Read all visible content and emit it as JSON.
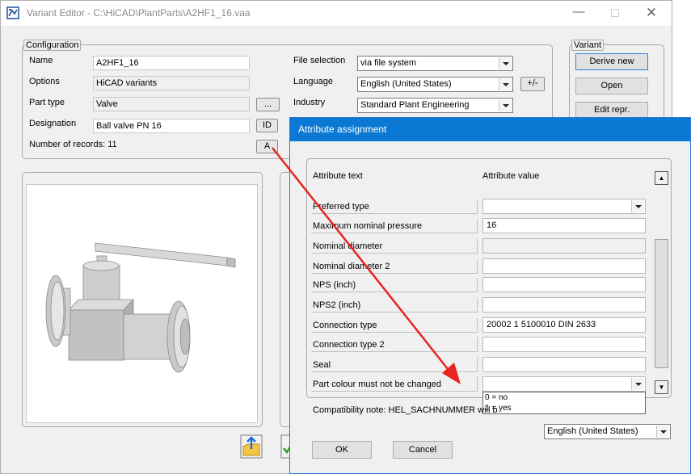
{
  "main_window": {
    "title": "Variant Editor - C:\\HiCAD\\PlantParts\\A2HF1_16.vaa",
    "configuration_group": "Configuration",
    "variant_group": "Variant",
    "fields": {
      "name_label": "Name",
      "name_value": "A2HF1_16",
      "options_label": "Options",
      "options_value": "HiCAD variants",
      "part_type_label": "Part type",
      "part_type_value": "Valve",
      "designation_label": "Designation",
      "designation_value": "Ball valve PN 16",
      "records_label": "Number of records: 11",
      "file_selection_label": "File selection",
      "file_selection_value": "via file system",
      "language_label": "Language",
      "language_value": "English (United States)",
      "industry_label": "Industry",
      "industry_value": "Standard Plant Engineering"
    },
    "buttons": {
      "browse": "...",
      "id": "ID",
      "a": "A",
      "plus_minus": "+/-",
      "derive_new": "Derive new",
      "open": "Open",
      "edit_repr": "Edit repr."
    }
  },
  "dialog": {
    "title": "Attribute assignment",
    "col_attr_text": "Attribute text",
    "col_attr_value": "Attribute value",
    "rows": [
      {
        "label": "Preferred type",
        "value": ""
      },
      {
        "label": "Maximum nominal pressure",
        "value": "16"
      },
      {
        "label": "Nominal diameter",
        "value": ""
      },
      {
        "label": "Nominal diameter 2",
        "value": ""
      },
      {
        "label": "NPS (inch)",
        "value": ""
      },
      {
        "label": "NPS2 (inch)",
        "value": ""
      },
      {
        "label": "Connection type",
        "value": "20002 1 5100010 DIN 2633"
      },
      {
        "label": "Connection type 2",
        "value": ""
      },
      {
        "label": "Seal",
        "value": ""
      },
      {
        "label": "Part colour must not be changed",
        "value": ""
      }
    ],
    "dropdown_options": [
      "0 = no",
      "1 = yes"
    ],
    "compat_note": "Compatibility note: HEL_SACHNUMMER will b",
    "language_value": "English (United States)",
    "ok": "OK",
    "cancel": "Cancel"
  },
  "icons": {
    "arrow_color": "#e8241c",
    "title_bar_accent": "#0b79d4"
  }
}
